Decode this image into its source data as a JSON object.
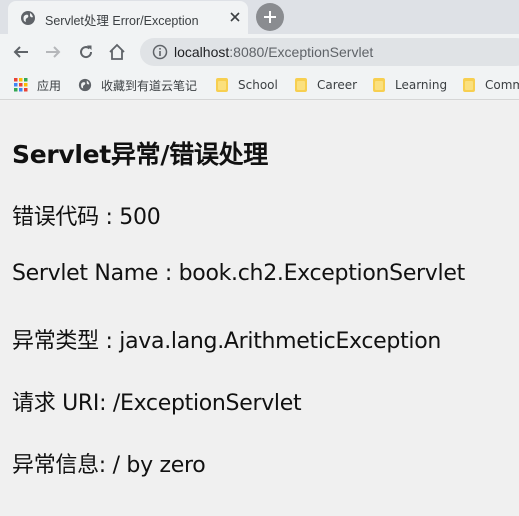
{
  "browser": {
    "tab": {
      "title": "Servlet处理 Error/Exception"
    },
    "address_bar": {
      "host": "localhost",
      "path": ":8080/ExceptionServlet"
    },
    "bookmarks": [
      {
        "label": "应用",
        "icon": "apps-grid-icon"
      },
      {
        "label": "收藏到有道云笔记",
        "icon": "globe-icon"
      },
      {
        "label": "School",
        "icon": "folder-icon"
      },
      {
        "label": "Career",
        "icon": "folder-icon"
      },
      {
        "label": "Learning",
        "icon": "folder-icon"
      },
      {
        "label": "Comm",
        "icon": "folder-icon"
      }
    ]
  },
  "page": {
    "title": "Servlet异常/错误处理",
    "lines": [
      "错误代码 : 500",
      "Servlet Name : book.ch2.ExceptionServlet",
      "异常类型 : java.lang.ArithmeticException",
      "请求 URI: /ExceptionServlet",
      "异常信息: / by zero"
    ]
  },
  "colors": {
    "tabstrip": "#dee1e6",
    "toolbar": "#f1f3f4",
    "page_bg": "#f0f0f0",
    "folder": "#f7cf50"
  }
}
